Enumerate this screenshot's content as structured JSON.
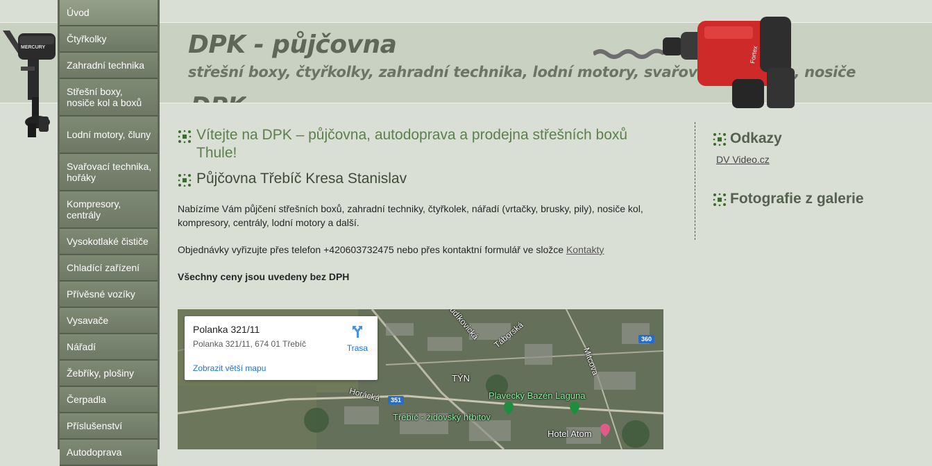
{
  "header": {
    "title": "DPK - půjčovna",
    "subtitle": "střešní boxy, čtyřkolky, zahradní technika, lodní motory, svařovací technika, nosiče",
    "title_ghost": "DPK"
  },
  "images": {
    "motor_brand": "MERCURY",
    "drill_brand": "Fortex"
  },
  "sidebar": {
    "items": [
      {
        "label": "Úvod"
      },
      {
        "label": "Čtyřkolky"
      },
      {
        "label": "Zahradní technika"
      },
      {
        "label": "Střešní boxy, nosiče kol a boxů"
      },
      {
        "label": "Lodní motory, čluny"
      },
      {
        "label": "Svařovací technika, hořáky"
      },
      {
        "label": "Kompresory, centrály"
      },
      {
        "label": "Vysokotlaké čističe"
      },
      {
        "label": "Chladící zařízení"
      },
      {
        "label": "Přívěsné vozíky"
      },
      {
        "label": "Vysavače"
      },
      {
        "label": "Nářadí"
      },
      {
        "label": "Žebříky, plošiny"
      },
      {
        "label": "Čerpadla"
      },
      {
        "label": "Příslušenství"
      },
      {
        "label": "Autodoprava"
      }
    ]
  },
  "main": {
    "welcome_heading": "Vítejte na DPK – půjčovna, autodoprava a prodejna střešních boxů Thule!",
    "section_heading": "Půjčovna Třebíč Kresa Stanislav",
    "intro": "Nabízíme Vám půjčení střešních boxů, zahradní techniky, čtyřkolek, nářadí (vrtačky, brusky, pily), nosiče kol, kompresory, centrály, lodní motory a další.",
    "orders_text": "Objednávky vyřizujte přes telefon +420603732475 nebo přes kontaktní formulář ve složce ",
    "contacts_link": "Kontakty",
    "vat_note": "Všechny ceny jsou uvedeny bez DPH"
  },
  "map": {
    "place_title": "Polanka 321/11",
    "place_address": "Polanka 321/11, 674 01 Třebíč",
    "route_label": "Trasa",
    "bigger_map_link": "Zobrazit větší mapu",
    "labels": {
      "budikovicka": "Budíkovická",
      "taborska": "Táborská",
      "mitcova": "Mitcova",
      "tyn": "TÝN",
      "horacka": "Horácká",
      "bazen": "Plavecký Bazén Laguna",
      "hrbitov": "Třebíč - židovský hřbitov",
      "hotel": "Hotel Atom"
    },
    "road_360": "360",
    "road_351": "351"
  },
  "right": {
    "links_heading": "Odkazy",
    "link_dv": "DV Video.cz",
    "gallery_heading": "Fotografie z galerie"
  },
  "colors": {
    "background": "#d9dfd5",
    "sidebar": "#707a67",
    "heading_green": "#5e7e4f",
    "map_link": "#1a73e8"
  }
}
